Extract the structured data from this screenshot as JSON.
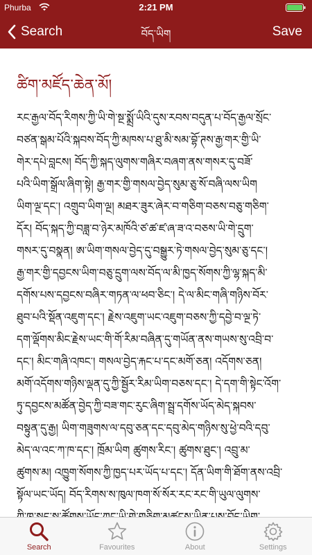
{
  "status": {
    "carrier": "Phurba",
    "time": "2:21 PM"
  },
  "nav": {
    "back_label": "Search",
    "title": "བོད་ཡིག",
    "save_label": "Save"
  },
  "entry": {
    "title": "ཚིག་མཛོད་ཆེན་མོ།",
    "lines": [
      "རང་རྒྱལ་བོད་རིགས་ཀྱི་ཡི་གེ་སྔ་སྨྲོ་ཡིའི་དུས་རབས་བདུན་པ་བོད་རྒྱལ་སྲོང་",
      "བཙན་སྒམ་པོའི་སྐབས་བོད་ཀྱི་མཁས་པ་ཐུ་མི་སམ་བྷོ་ཊས་རྒྱ་གར་གྱི་ཡི་",
      "གེར་དཔེ་བླངས། བོད་ཀྱི་སྐད་ལུགས་གཞིར་བཞག་ནས་གསར་དུ་བཟོ་",
      "པའི་ཡིག་སྒྲོལ་ཞིག་སྟེ། རྒྱ་གར་གྱི་གསལ་བྱེད་སུམ་ཅུ་སོ་བཞི་ལས་ཡིག",
      "ཡིག་ལྔ་དང་། འགྲུབ་ཡིག་ལྔ། མཐར་ཟུར་ཞེར་བ་གཅིག་བཅས་བཅུ་གཅིག་",
      "དོར། བོད་སྐད་ཀྱི་བཟླ་བ་ཉེར་མཁོའི་ཙ་ཚ་ཛ་ཞ་ཟ་འ་བཅས་ཡི་གེ་དྲུག་",
      "གསར་དུ་བསྣན། ཨ་ཡིག་གསལ་བྱེད་དུ་བསྒྱུར་ཏེ་གསལ་བྱེད་སུམ་ཅུ་དང་།",
      "རྒྱ་གར་གྱི་དབྱངས་ཡིག་བཅུ་དྲུག་ལས་བོད་ལ་མི་ཁྱད་སོགས་ཀྱི་ལྷ་སྐད་མི་",
      "དགོས་པས་དབྱངས་བཞིར་གཏན་ལ་ཕབ་ཅིང་། དེ་ལ་མིང་གཞི་གཉིས་བོར་",
      "ཐུབ་པའི་སྡོན་འཇུག་དང་། རྗེས་འཇུག་ཡང་འཇུག་བཅས་ཀྱི་དབྱེ་བ་ལྔ་ཏེ་",
      "དག་ལྡོགས་མིང་རྗེས་ཡང་གི་གོ་རིམ་བཞིན་དུ་གཡོན་ནས་གཡས་སུ་འབྲི་བ་",
      "དང་། མིང་གཞི་འཁང་། གསལ་བྱེད་རྐང་པ་དང་མགོ་ཅན། འདོགས་ཅན།",
      "མགོ་འདོགས་གཉིས་ལྡན་དུ་ཀྱི་སྦྱོར་རིམ་ཡིག་བཅས་དང་། དེ་དག་གི་སྟེང་འོག་",
      "ཏུ་དབྱངས་མཚོན་བྱེད་ཀྱི་བཟ་གང་རུང་ཞིག་སྦྲ་དགོས་ཡོད་མེད་སྐབས་",
      "བསྟུན་དུ་རྒྱ། ཡིག་གཟུགས་ལ་དབུ་ཅན་དང་དབུ་མེད་གཉིས་སུ་ཕྱེ་བའི་དབུ་",
      "མེད་ལ་འང་ཀ་ཁ་དང་། ཁྲོམ་ཡིག ཚུགས་རིང་། ཚུགས་ཐུང་། འབྲུ་མ་",
      "ཚུགས་མ། འཁྱུག་སོགས་ཀྱི་ཁྱད་པར་ཡོད་པ་དང་། དོན་ཡིག་གི་ཐོག་ནས་འབྲི་",
      "སྟོལ་ཡང་ཡོད། བོད་རིགས་ས་ཁུལ་ཁག་སོ་སོར་རང་རང་གི་ཡུལ་ལུགས་",
      "ཀྱི་ཁ་སྐད་སྣ་ཚོགས་ཡོད་ཀྱང་ཡི་གེ་གཅིག་མཚུངས་ཡིན་པས་བོད་ཡིག་"
    ]
  },
  "tabs": [
    {
      "label": "Search",
      "icon": "search-icon"
    },
    {
      "label": "Favourites",
      "icon": "star-icon"
    },
    {
      "label": "About",
      "icon": "info-icon"
    },
    {
      "label": "Settings",
      "icon": "gear-icon"
    }
  ],
  "colors": {
    "brand": "#8e1b1b",
    "tab_inactive": "#9a9a9a",
    "tab_bar_bg": "#f7f7f7"
  }
}
